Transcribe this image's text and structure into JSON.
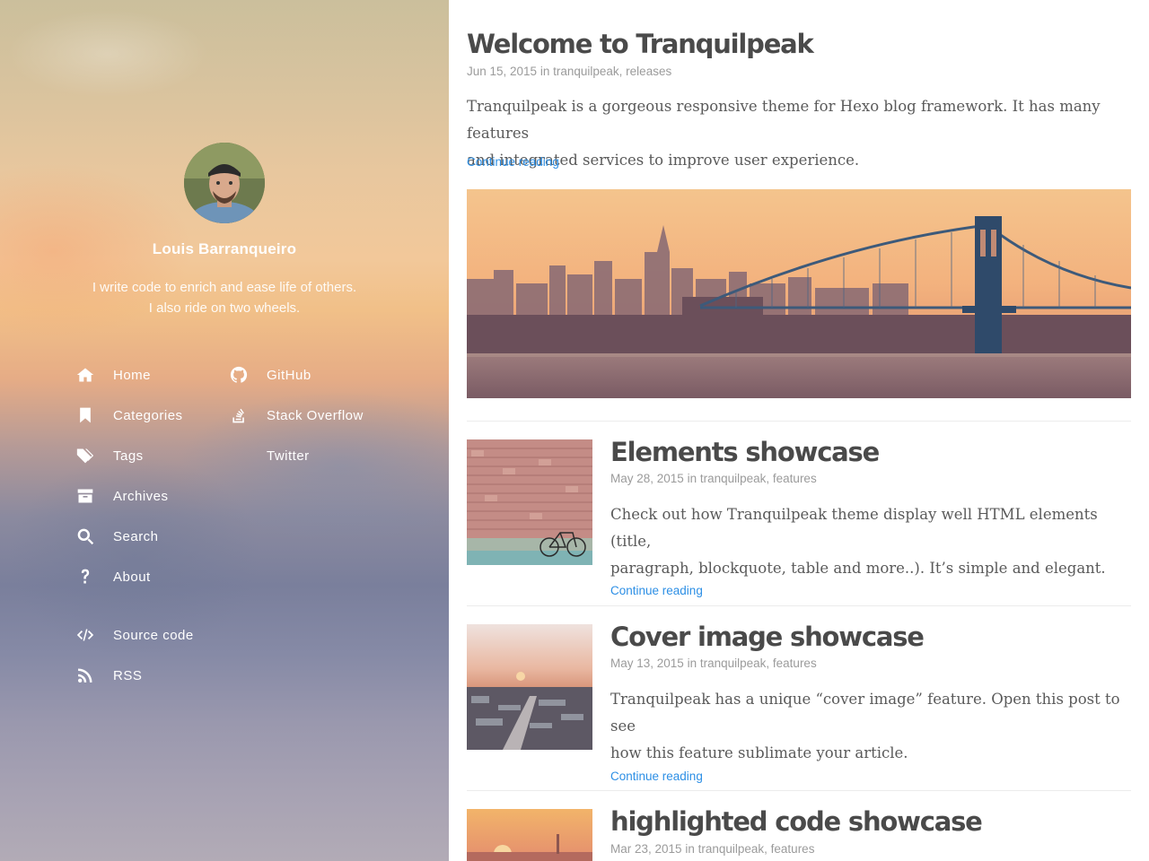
{
  "sidebar": {
    "author": "Louis Barranqueiro",
    "bio_line1": "I write code to enrich and ease life of others.",
    "bio_line2": "I also ride on two wheels.",
    "nav_left": [
      {
        "label": "Home",
        "icon": "home-icon"
      },
      {
        "label": "Categories",
        "icon": "bookmark-icon"
      },
      {
        "label": "Tags",
        "icon": "tags-icon"
      },
      {
        "label": "Archives",
        "icon": "archive-icon"
      },
      {
        "label": "Search",
        "icon": "search-icon"
      },
      {
        "label": "About",
        "icon": "question-icon"
      }
    ],
    "nav_right": [
      {
        "label": "GitHub",
        "icon": "github-icon"
      },
      {
        "label": "Stack Overflow",
        "icon": "stackoverflow-icon"
      },
      {
        "label": "Twitter",
        "icon": ""
      }
    ],
    "nav_bottom": [
      {
        "label": "Source code",
        "icon": "code-icon"
      },
      {
        "label": "RSS",
        "icon": "rss-icon"
      }
    ]
  },
  "posts": [
    {
      "title": "Welcome to Tranquilpeak",
      "date": "Jun 15, 2015",
      "in": "in",
      "categories": "tranquilpeak, releases",
      "excerpt_line1": "Tranquilpeak is a gorgeous responsive theme for Hexo blog framework. It has many features",
      "excerpt_line2": "and integrated services to improve user experience.",
      "continue": "Continue reading"
    },
    {
      "title": "Elements showcase",
      "date": "May 28, 2015",
      "in": "in",
      "categories": "tranquilpeak, features",
      "excerpt_line1": "Check out how Tranquilpeak theme display well HTML elements (title,",
      "excerpt_line2": "paragraph, blockquote, table and more..). It’s simple and elegant.",
      "continue": "Continue reading"
    },
    {
      "title": "Cover image showcase",
      "date": "May 13, 2015",
      "in": "in",
      "categories": "tranquilpeak, features",
      "excerpt_line1": "Tranquilpeak has a unique “cover image” feature. Open this post to see",
      "excerpt_line2": "how this feature sublimate your article.",
      "continue": "Continue reading"
    },
    {
      "title": "highlighted code showcase",
      "date": "Mar 23, 2015",
      "in": "in",
      "categories": "tranquilpeak, features"
    }
  ],
  "colors": {
    "link": "#2d8fe5",
    "title": "#4a4a4a",
    "meta": "#9b9b9b",
    "excerpt": "#5a5a5a"
  }
}
